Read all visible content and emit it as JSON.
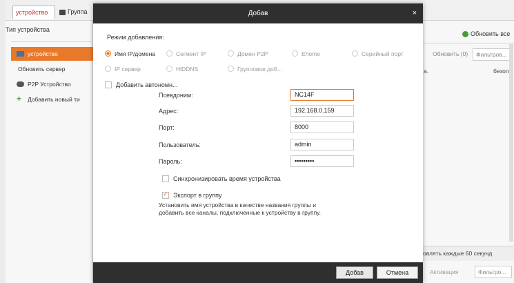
{
  "background": {
    "tabs": {
      "device": "устройство",
      "group": "Группа"
    },
    "left": {
      "header": "Тип устройства",
      "items": [
        {
          "label": "устройство",
          "icon": "device-icon"
        },
        {
          "label": "Обновить сервер"
        },
        {
          "label": "P2P Устройство",
          "icon": "cloud-icon"
        },
        {
          "label": "Добавить новый ти",
          "icon": "plus-icon"
        }
      ]
    },
    "right": {
      "refresh_all": "Обновить все",
      "refresh_count": "Обновить (0)",
      "filter": "Фильтров...",
      "col_a": "а.",
      "col_b": "безопа",
      "auto_refresh": "овлять каждые 60 секунд",
      "activation": "Активация",
      "filter2": "Фильтро..."
    }
  },
  "dialog": {
    "title": "Добав",
    "close_glyph": "×",
    "mode_label": "Режим добавления:",
    "modes": [
      "Имя IP/домена",
      "Сегмент IP",
      "Домен P2P",
      "Ehome",
      "Серийный порт",
      "IP сервер",
      "HiDDNS",
      "Групповое доб..."
    ],
    "offline_add": "Добавить автономн...",
    "fields": {
      "alias_label": "Псевдоним:",
      "alias_value": "NC14F",
      "address_label": "Адрес:",
      "address_value": "192.168.0.159",
      "port_label": "Порт:",
      "port_value": "8000",
      "user_label": "Пользователь:",
      "user_value": "admin",
      "password_label": "Пароль:",
      "password_value": "•••••••••"
    },
    "sync_time": "Синхронизировать время устройства",
    "export_group": "Экспорт в группу",
    "note_line1": "Установить имя устройства в качестве названия группы и",
    "note_line2": "добавить все каналы, подключенные к устройству в группу.",
    "add_button": "Добав",
    "cancel_button": "Отмена"
  },
  "colors": {
    "accent": "#e8792a",
    "titlebar": "#2f2f2f"
  }
}
